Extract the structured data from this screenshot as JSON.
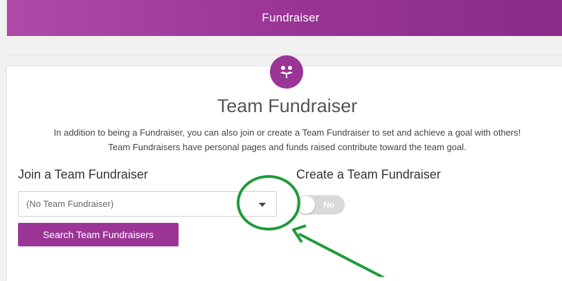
{
  "header": {
    "title": "Fundraiser"
  },
  "badge": {
    "icon": "team-people-icon",
    "color": "#9a3596"
  },
  "main": {
    "title": "Team Fundraiser",
    "description_line1": "In addition to being a Fundraiser, you can also join or create a Team Fundraiser to set and achieve a goal with others!",
    "description_line2": "Team Fundraisers have personal pages and funds raised contribute toward the team goal."
  },
  "join": {
    "heading": "Join a Team Fundraiser",
    "selected_value": "(No Team Fundraiser)",
    "search_button_label": "Search Team Fundraisers"
  },
  "create": {
    "heading": "Create a Team Fundraiser",
    "toggle_label": "No",
    "toggle_state": "off"
  },
  "colors": {
    "brand": "#9a3596",
    "annotation": "#1f9a3a"
  }
}
